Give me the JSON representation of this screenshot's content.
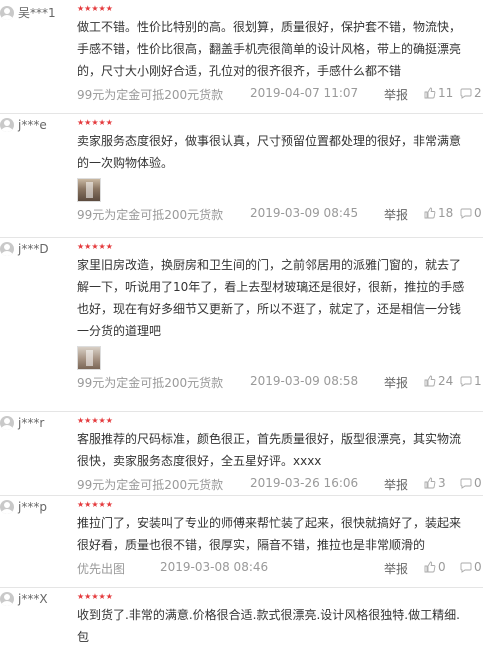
{
  "reviews": [
    {
      "user": "吴***1",
      "stars": "★★★★★",
      "content": "做工不错。性价比特别的高。很划算，质量很好，保护套不错，物流快，手感不错，性价比很高，翻盖手机壳很简单的设计风格，带上的确挺漂亮的，尺寸大小刚好合适，孔位对的很齐很齐，手感什么都不错",
      "has_image": false,
      "tag": "99元为定金可抵200元货款",
      "date": "2019-04-07 11:07",
      "report": "举报",
      "likes": "11",
      "replies": "2"
    },
    {
      "user": "j***e",
      "stars": "★★★★★",
      "content": "卖家服务态度很好，做事很认真，尺寸预留位置都处理的很好，非常满意的一次购物体验。",
      "has_image": true,
      "tag": "99元为定金可抵200元货款",
      "date": "2019-03-09 08:45",
      "report": "举报",
      "likes": "18",
      "replies": "0"
    },
    {
      "user": "j***D",
      "stars": "★★★★★",
      "content": "家里旧房改造，换厨房和卫生间的门，之前邻居用的派雅门窗的，就去了解一下，听说用了10年了，看上去型材玻璃还是很好，很新，推拉的手感也好，现在有好多细节又更新了，所以不逛了，就定了，还是相信一分钱一分货的道理吧",
      "has_image": true,
      "tag": "99元为定金可抵200元货款",
      "date": "2019-03-09 08:58",
      "report": "举报",
      "likes": "24",
      "replies": "1"
    },
    {
      "user": "j***r",
      "stars": "★★★★★",
      "content": "客服推荐的尺码标准，颜色很正，首先质量很好，版型很漂亮，其实物流很快，卖家服务态度很好，全五星好评。xxxx",
      "has_image": false,
      "tag": "99元为定金可抵200元货款",
      "date": "2019-03-26 16:06",
      "report": "举报",
      "likes": "3",
      "replies": "0"
    },
    {
      "user": "j***p",
      "stars": "★★★★★",
      "content": "推拉门了，安装叫了专业的师傅来帮忙装了起来，很快就搞好了，装起来很好看，质量也很不错，很厚实，隔音不错，推拉也是非常顺滑的",
      "has_image": false,
      "tag": "优先出图",
      "date": "2019-03-08 08:46",
      "report": "举报",
      "likes": "0",
      "replies": "0"
    },
    {
      "user": "j***X",
      "stars": "★★★★★",
      "content": "收到货了.非常的满意.价格很合适.款式很漂亮.设计风格很独特.做工精细.包",
      "has_image": false,
      "tag": "",
      "date": "",
      "report": "",
      "likes": "",
      "replies": ""
    }
  ],
  "icons": {
    "like": "thumbs-up-icon",
    "reply": "comment-icon",
    "avatar": "user-avatar-icon"
  },
  "colors": {
    "star": "#e4393c",
    "meta": "#999999",
    "divider": "#e5e5e5"
  }
}
